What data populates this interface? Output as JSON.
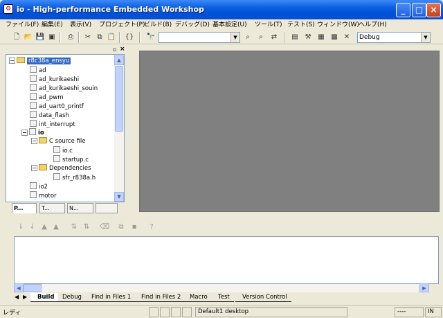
{
  "window": {
    "title": "io - High-performance Embedded Workshop"
  },
  "menu": [
    "ファイル(F)",
    "編集(E)",
    "表示(V)",
    "プロジェクト(P)",
    "ビルド(B)",
    "デバッグ(D)",
    "基本設定(U)",
    "ツール(T)",
    "テスト(S)",
    "ウィンドウ(W)",
    "ヘルプ(H)"
  ],
  "toolbar": {
    "session_value": "Debug",
    "search_value": ""
  },
  "tree": {
    "root": "r8c38a_ensyu",
    "items": [
      "ad",
      "ad_kurikaeshi",
      "ad_kurikaeshi_souin",
      "ad_pwm",
      "ad_uart0_printf",
      "data_flash",
      "int_interrupt"
    ],
    "io": "io",
    "c_source": "C source file",
    "c_files": [
      "io.c",
      "startup.c"
    ],
    "dependencies": "Dependencies",
    "dep_files": [
      "sfr_r838a.h"
    ],
    "more": [
      "io2",
      "motor"
    ]
  },
  "left_tabs": [
    "P...",
    "T...",
    "N...",
    ""
  ],
  "output_tabs": [
    "Build",
    "Debug",
    "Find in Files 1",
    "Find in Files 2",
    "Macro",
    "Test",
    "Version Control"
  ],
  "status": {
    "left": "レディ",
    "session": "Default1 desktop",
    "pos": "----",
    "mode": "IN"
  }
}
